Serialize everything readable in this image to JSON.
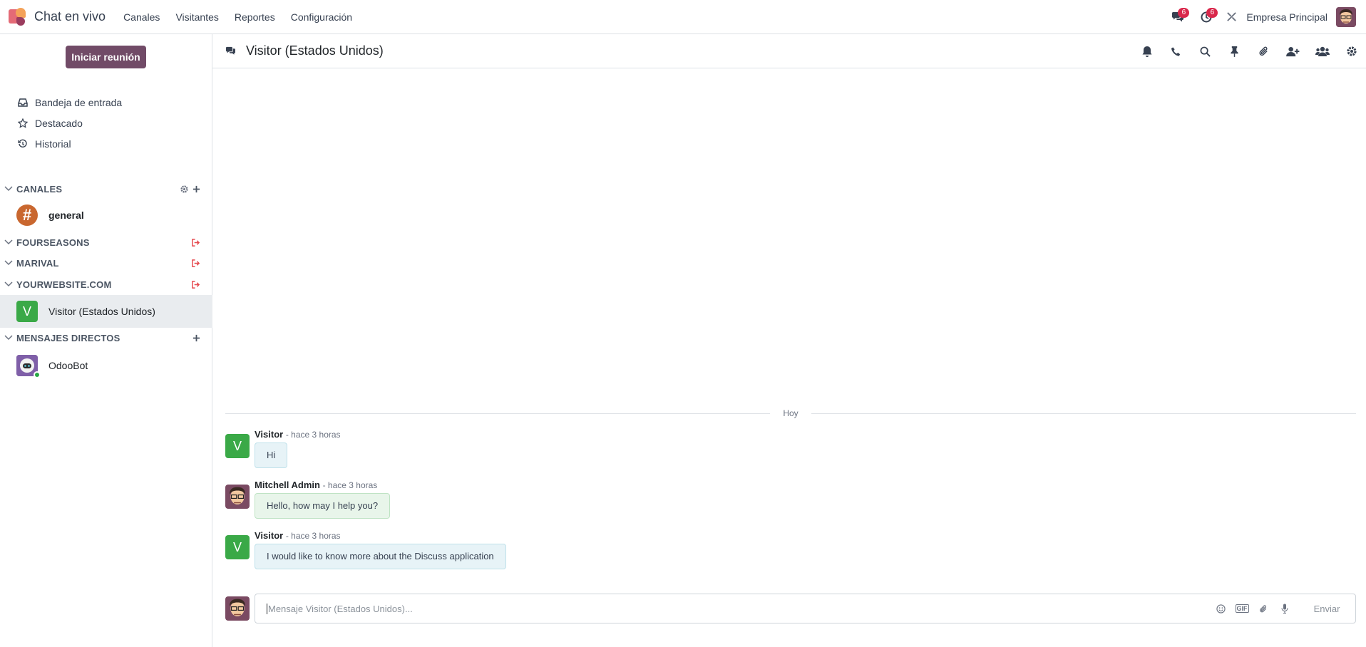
{
  "navbar": {
    "app_name": "Chat en vivo",
    "menu": [
      "Canales",
      "Visitantes",
      "Reportes",
      "Configuración"
    ],
    "messages_badge": "6",
    "activities_badge": "6",
    "company": "Empresa Principal"
  },
  "sidebar": {
    "start_meeting": "Iniciar reunión",
    "mailboxes": [
      {
        "label": "Bandeja de entrada",
        "icon": "inbox-icon"
      },
      {
        "label": "Destacado",
        "icon": "star-icon"
      },
      {
        "label": "Historial",
        "icon": "history-icon"
      }
    ],
    "categories": {
      "channels": "CANALES",
      "fourseasons": "FOURSEASONS",
      "marival": "MARIVAL",
      "yourwebsite": "YOURWEBSITE.COM",
      "direct": "MENSAJES DIRECTOS"
    },
    "channels": {
      "general": {
        "name": "general",
        "glyph": "#"
      },
      "visitor": {
        "name": "Visitor (Estados Unidos)",
        "glyph": "V"
      },
      "odoobot": {
        "name": "OdooBot"
      }
    }
  },
  "thread": {
    "title": "Visitor (Estados Unidos)",
    "date_separator": "Hoy",
    "messages": [
      {
        "author": "Visitor",
        "time": "- hace 3 horas",
        "body": "Hi",
        "avatar_glyph": "V"
      },
      {
        "author": "Mitchell Admin",
        "time": "- hace 3 horas",
        "body": "Hello, how may I help you?"
      },
      {
        "author": "Visitor",
        "time": "- hace 3 horas",
        "body": "I would like to know more about the Discuss application",
        "avatar_glyph": "V"
      }
    ]
  },
  "composer": {
    "placeholder": "Mensaje Visitor (Estados Unidos)...",
    "gif_label": "GIF",
    "send_label": "Enviar"
  },
  "colors": {
    "brand": "#714b67",
    "visitor_avatar": "#3aa947",
    "general_avatar": "#c9672f",
    "badge": "#d9274b",
    "leave_icon": "#e5484d"
  }
}
